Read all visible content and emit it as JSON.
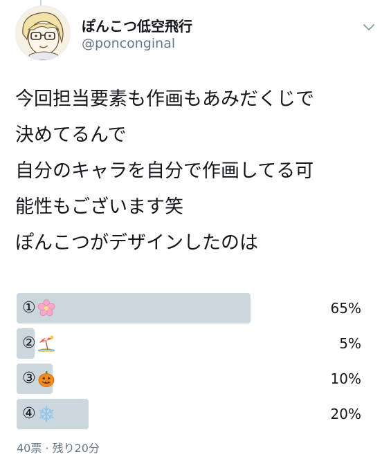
{
  "user": {
    "display_name": "ぽんこつ低空飛行",
    "handle": "@ponconginal"
  },
  "tweet": {
    "lines": [
      "今回担当要素も作画もあみだくじで",
      "決めてるんで",
      "自分のキャラを自分で作画してる可",
      "能性もございます笑",
      "ぽんこつがデザインしたのは"
    ]
  },
  "poll": {
    "options": [
      {
        "number": "①",
        "emoji": "cherry-blossom-icon",
        "percent_label": "65%",
        "percent": 65
      },
      {
        "number": "②",
        "emoji": "beach-umbrella-icon",
        "percent_label": "5%",
        "percent": 5
      },
      {
        "number": "③",
        "emoji": "jack-o-lantern-icon",
        "percent_label": "10%",
        "percent": 10
      },
      {
        "number": "④",
        "emoji": "snowflake-icon",
        "percent_label": "20%",
        "percent": 20
      }
    ],
    "footer": "40票 · 残り20分"
  },
  "colors": {
    "bar": "#ccd6dd",
    "secondary_text": "#657786",
    "primary_text": "#14171a"
  }
}
